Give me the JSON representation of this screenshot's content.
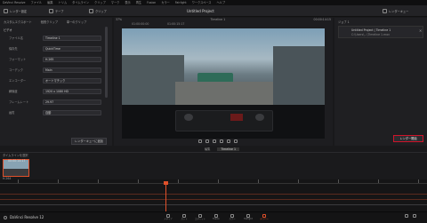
{
  "menu": {
    "items": [
      "DaVinci Resolve",
      "ファイル",
      "編集",
      "トリム",
      "タイムライン",
      "クリップ",
      "マーク",
      "表示",
      "再生",
      "Fusion",
      "カラー",
      "Fairlight",
      "ワークスペース",
      "ヘルプ"
    ]
  },
  "toolbar": {
    "render_settings": "レンダー設定",
    "tape": "テープ",
    "clip": "クリップ",
    "project_title": "Untitled Project",
    "render_queue": "レンダーキュー"
  },
  "left_panel": {
    "tabs": [
      "カスタムエクスポート",
      "個別クリップ",
      "単一のクリップ"
    ],
    "section_title": "ビデオ",
    "fields": [
      {
        "label": "ファイル名",
        "value": "Timeline 1"
      },
      {
        "label": "保存先",
        "value": "QuickTime"
      },
      {
        "label": "フォーマット",
        "value": "H.265"
      },
      {
        "label": "コーデック",
        "value": "Main"
      },
      {
        "label": "エンコーダー",
        "value": "オートマチック"
      },
      {
        "label": "解像度",
        "value": "1920 x 1080 HD"
      },
      {
        "label": "フレームレート",
        "value": "29.97"
      },
      {
        "label": "画質",
        "value": "自動"
      }
    ],
    "add_queue_button": "レンダーキューに追加"
  },
  "viewer": {
    "zoom": "37%",
    "timecode_left": "01:00:00:00",
    "timeline_name": "Timeline 1",
    "timecode_mid": "01:00:15:17",
    "timecode_right": "00:00:14:15",
    "tabs": [
      "編集",
      "Timeline 1"
    ]
  },
  "render_queue": {
    "title": "ジョブ 1",
    "job_name": "Untitled Project | Timeline 1",
    "job_sub": "C:\\Users\\...\\Timeline 1.mov",
    "render_all_button": "レンダー開始"
  },
  "clip_strip": {
    "label": "タイムラインを選択",
    "clip_name": "00:00:14:17",
    "clip_sub": "H.264"
  },
  "footer": {
    "app": "DaVinci Resolve 12",
    "pages": [
      "メディア",
      "カット",
      "エディット",
      "Fusion",
      "カラー",
      "Fairlight",
      "デリバー"
    ]
  },
  "colors": {
    "accent_red": "#d0142a",
    "playhead": "#e0502a",
    "bg": "#19191b"
  }
}
